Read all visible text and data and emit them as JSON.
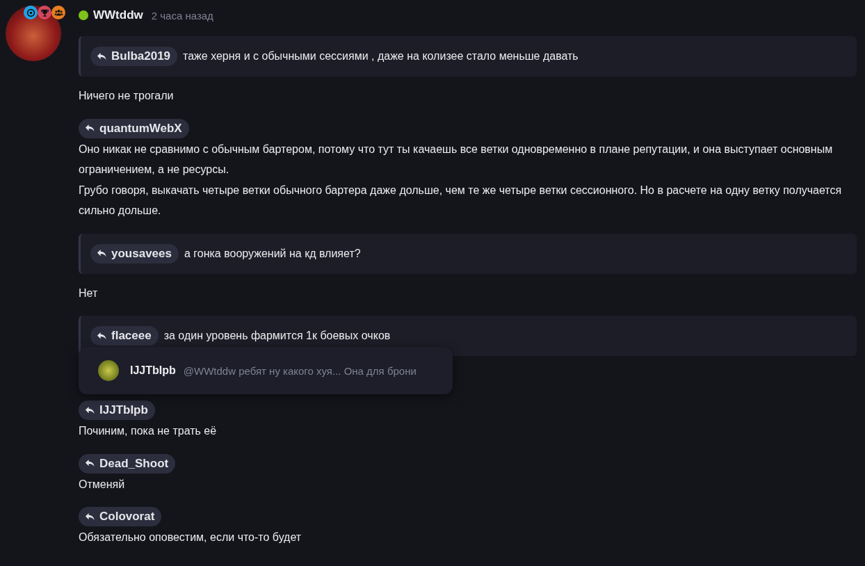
{
  "post": {
    "author": "WWtddw",
    "online": true,
    "time": "2 часа назад",
    "badges": [
      {
        "kind": "emblem",
        "color": "#1fa3e8"
      },
      {
        "kind": "trophy",
        "color": "#d4465e"
      },
      {
        "kind": "group",
        "color": "#e67e22"
      }
    ]
  },
  "blocks": [
    {
      "kind": "quote",
      "user": "Bulba2019",
      "text": "таже херня и с обычными сессиями , даже на колизее стало меньше давать"
    },
    {
      "kind": "text",
      "paragraphs": [
        "Ничего не трогали"
      ]
    },
    {
      "kind": "reply",
      "user": "quantumWebX",
      "paragraphs": [
        "Оно никак не сравнимо с обычным бартером, потому что тут ты качаешь все ветки одновременно в плане репутации, и она выступает основным ограничением, а не ресурсы.",
        "Грубо говоря, выкачать четыре ветки обычного бартера даже дольше, чем те же четыре ветки сессионного. Но в расчете на одну ветку получается сильно дольше."
      ]
    },
    {
      "kind": "quote",
      "user": "yousavees",
      "text": "а гонка вооружений на кд влияет?"
    },
    {
      "kind": "text",
      "paragraphs": [
        "Нет"
      ]
    },
    {
      "kind": "quote",
      "user": "flaceee",
      "text": "за один уровень фармится 1к боевых очков"
    },
    {
      "kind": "popup",
      "user": "IJJTbIpb",
      "preview": "@WWtddw ребят ну какого хуя... Она для брони"
    },
    {
      "kind": "reply",
      "user": "IJJTbIpb",
      "paragraphs": [
        "Починим, пока не трать её"
      ]
    },
    {
      "kind": "reply",
      "user": "Dead_Shoot",
      "paragraphs": [
        "Отменяй"
      ]
    },
    {
      "kind": "reply",
      "user": "Colovorat",
      "paragraphs": [
        "Обязательно оповестим, если что-то будет"
      ]
    }
  ]
}
